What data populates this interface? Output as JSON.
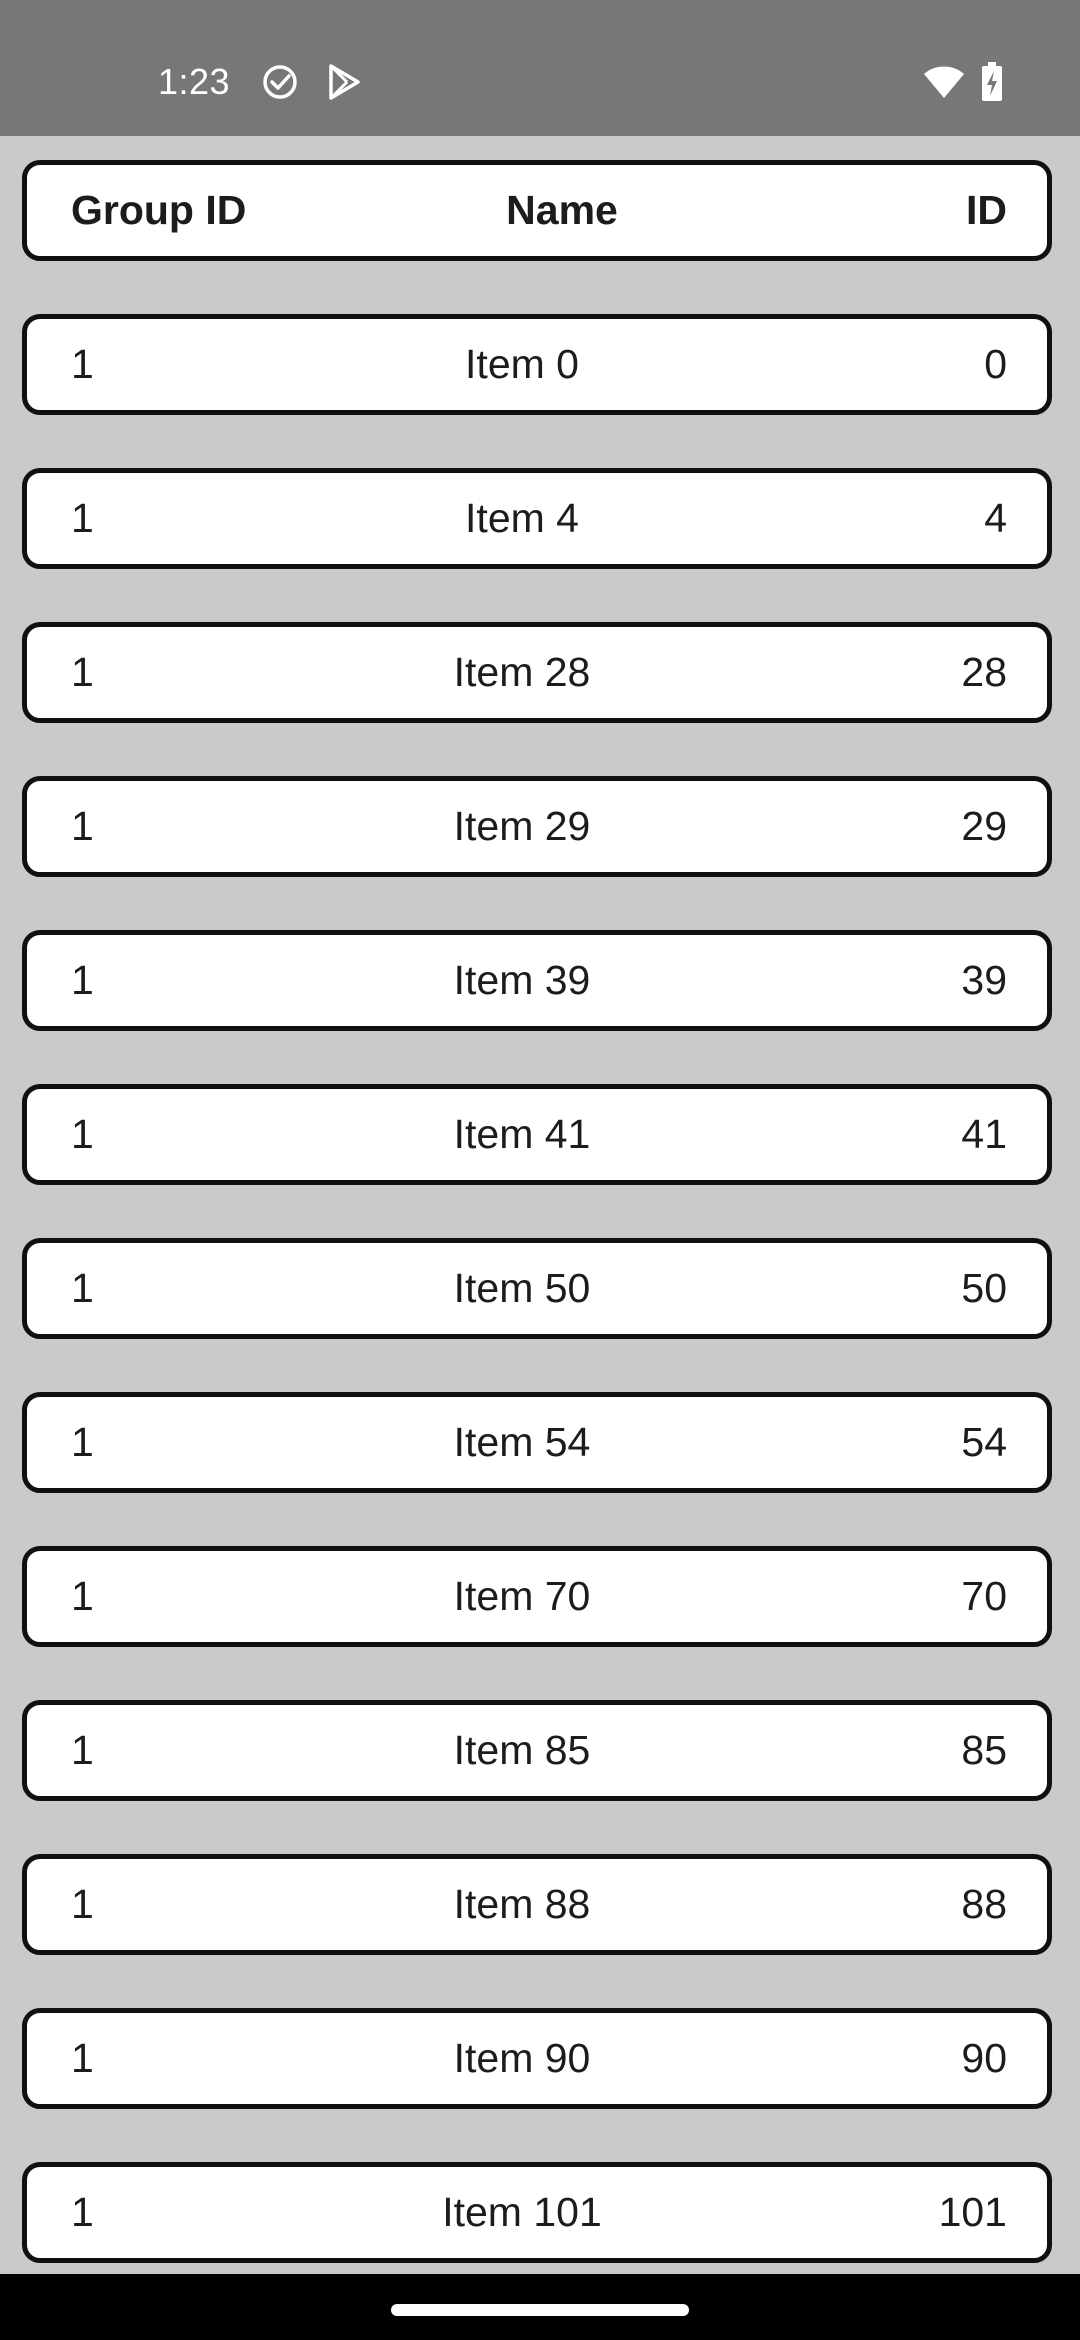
{
  "status_bar": {
    "time": "1:23",
    "icons_left": [
      "check-circle-icon",
      "play-store-icon"
    ],
    "icons_right": [
      "wifi-icon",
      "battery-charging-icon"
    ]
  },
  "table": {
    "headers": {
      "group_id": "Group ID",
      "name": "Name",
      "id": "ID"
    },
    "rows": [
      {
        "group_id": "1",
        "name": "Item 0",
        "id": "0"
      },
      {
        "group_id": "1",
        "name": "Item 4",
        "id": "4"
      },
      {
        "group_id": "1",
        "name": "Item 28",
        "id": "28"
      },
      {
        "group_id": "1",
        "name": "Item 29",
        "id": "29"
      },
      {
        "group_id": "1",
        "name": "Item 39",
        "id": "39"
      },
      {
        "group_id": "1",
        "name": "Item 41",
        "id": "41"
      },
      {
        "group_id": "1",
        "name": "Item 50",
        "id": "50"
      },
      {
        "group_id": "1",
        "name": "Item 54",
        "id": "54"
      },
      {
        "group_id": "1",
        "name": "Item 70",
        "id": "70"
      },
      {
        "group_id": "1",
        "name": "Item 85",
        "id": "85"
      },
      {
        "group_id": "1",
        "name": "Item 88",
        "id": "88"
      },
      {
        "group_id": "1",
        "name": "Item 90",
        "id": "90"
      },
      {
        "group_id": "1",
        "name": "Item 101",
        "id": "101"
      }
    ]
  },
  "colors": {
    "status_bar_bg": "#777777",
    "page_bg": "#cacaca",
    "row_bg": "#ffffff",
    "row_border": "#101010",
    "nav_bar_bg": "#000000"
  }
}
